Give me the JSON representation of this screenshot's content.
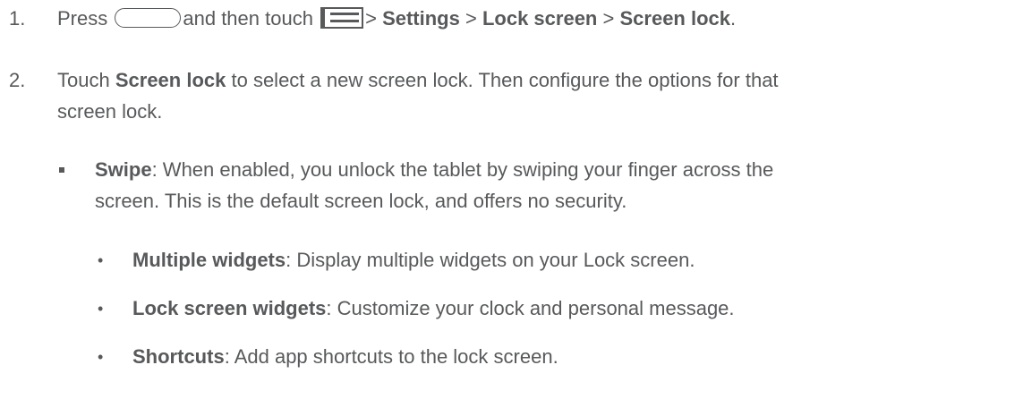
{
  "step1": {
    "number": "1.",
    "press": "Press",
    "home_button_icon": "home-button-icon",
    "and_then_touch": "and then touch",
    "menu_icon": "menu-icon",
    "sep1": ">",
    "settings": "Settings",
    "sep2": ">",
    "lock_screen": "Lock screen",
    "sep3": ">",
    "screen_lock": "Screen lock",
    "end": "."
  },
  "step2": {
    "number": "2.",
    "touch": "Touch",
    "screen_lock": "Screen lock",
    "rest_line1": "to select a new screen lock. Then configure the options for that",
    "line2": "screen lock."
  },
  "swipe": {
    "title": "Swipe",
    "text_line1": ": When enabled, you unlock the tablet by swiping your finger across the",
    "text_line2": "screen. This is the default screen lock, and offers no security."
  },
  "sub_items": [
    {
      "title": "Multiple widgets",
      "text": ": Display multiple widgets on your Lock screen."
    },
    {
      "title": "Lock screen widgets",
      "text": ": Customize your clock and personal message."
    },
    {
      "title": "Shortcuts",
      "text": ": Add app shortcuts to the lock screen."
    }
  ],
  "colors": {
    "text": "#58595b",
    "background": "#ffffff"
  }
}
